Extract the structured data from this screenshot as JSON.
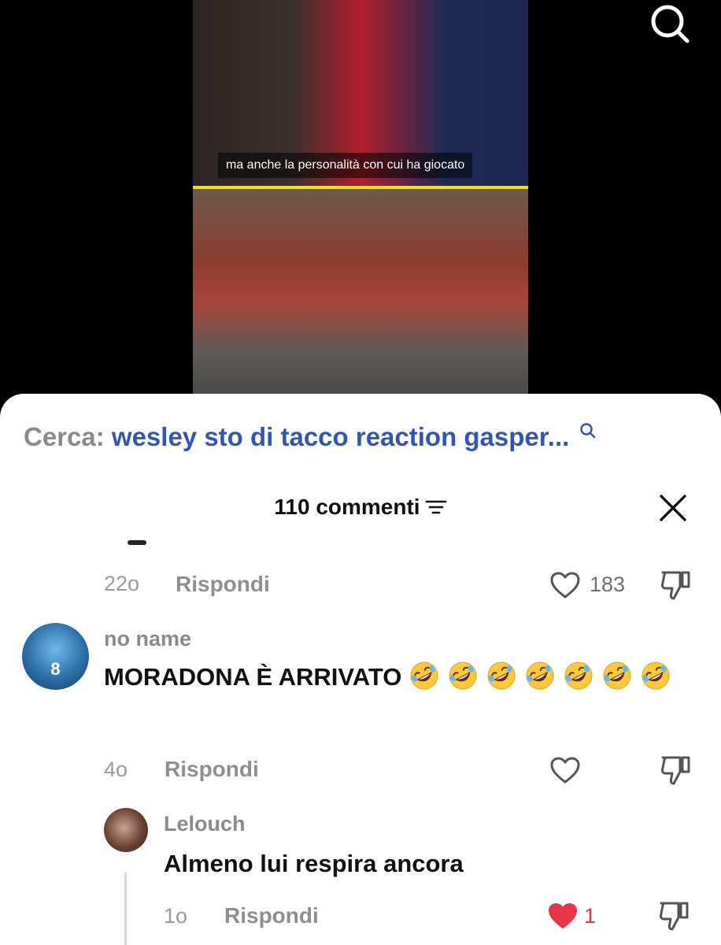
{
  "video": {
    "subtitle": "ma anche la personalità con cui ha giocato"
  },
  "sheet": {
    "search_label": "Cerca:",
    "search_query": "wesley sto di tacco reaction gasper...",
    "comments_count_label": "110 commenti"
  },
  "comments": [
    {
      "time": "22o",
      "reply_label": "Rispondi",
      "likes": "183"
    },
    {
      "username": "no name",
      "avatar_number": "8",
      "text": "MORADONA È ARRIVATO",
      "emoji_count": 7,
      "time": "4o",
      "reply_label": "Rispondi",
      "likes": ""
    },
    {
      "username": "Lelouch",
      "text": "Almeno lui respira ancora",
      "time": "1o",
      "reply_label": "Rispondi",
      "likes": "1",
      "liked": true
    }
  ],
  "icons": {
    "search": "search-icon",
    "sort": "sort-icon",
    "close": "close-icon",
    "heart": "heart-icon",
    "dislike": "dislike-icon",
    "emoji": "rolling-on-floor-laughing-emoji"
  },
  "colors": {
    "query_blue": "#3256b6",
    "like_red": "#e8344a",
    "muted_gray": "#8a8a8a"
  }
}
